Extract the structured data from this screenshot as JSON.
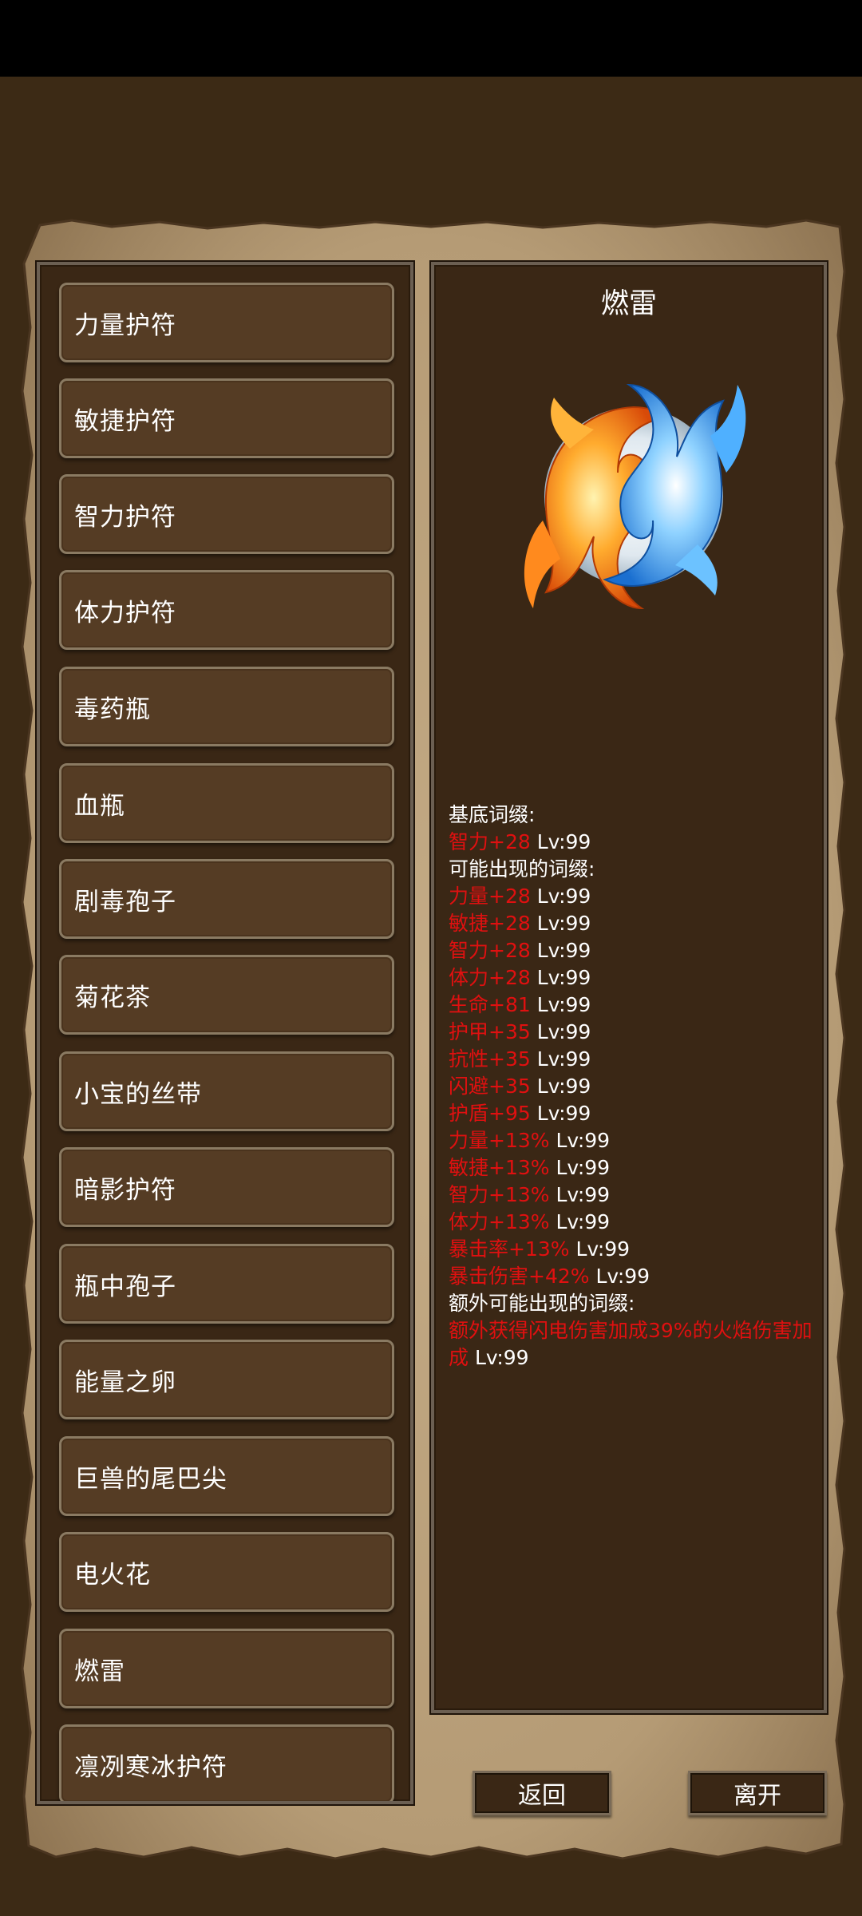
{
  "list": {
    "items": [
      {
        "label": "力量护符"
      },
      {
        "label": "敏捷护符"
      },
      {
        "label": "智力护符"
      },
      {
        "label": "体力护符"
      },
      {
        "label": "毒药瓶"
      },
      {
        "label": "血瓶"
      },
      {
        "label": "剧毒孢子"
      },
      {
        "label": "菊花茶"
      },
      {
        "label": "小宝的丝带"
      },
      {
        "label": "暗影护符"
      },
      {
        "label": "瓶中孢子"
      },
      {
        "label": "能量之卵"
      },
      {
        "label": "巨兽的尾巴尖"
      },
      {
        "label": "电火花"
      },
      {
        "label": "燃雷"
      },
      {
        "label": "凛冽寒冰护符"
      }
    ]
  },
  "detail": {
    "title": "燃雷",
    "icon": "fire-ice-yin-yang-icon",
    "base_header": "基底词缀:",
    "base_affixes": [
      {
        "stat": "智力+28",
        "level": "Lv:99"
      }
    ],
    "possible_header": "可能出现的词缀:",
    "possible_affixes": [
      {
        "stat": "力量+28",
        "level": "Lv:99"
      },
      {
        "stat": "敏捷+28",
        "level": "Lv:99"
      },
      {
        "stat": "智力+28",
        "level": "Lv:99"
      },
      {
        "stat": "体力+28",
        "level": "Lv:99"
      },
      {
        "stat": "生命+81",
        "level": "Lv:99"
      },
      {
        "stat": "护甲+35",
        "level": "Lv:99"
      },
      {
        "stat": "抗性+35",
        "level": "Lv:99"
      },
      {
        "stat": "闪避+35",
        "level": "Lv:99"
      },
      {
        "stat": "护盾+95",
        "level": "Lv:99"
      },
      {
        "stat": "力量+13%",
        "level": "Lv:99"
      },
      {
        "stat": "敏捷+13%",
        "level": "Lv:99"
      },
      {
        "stat": "智力+13%",
        "level": "Lv:99"
      },
      {
        "stat": "体力+13%",
        "level": "Lv:99"
      },
      {
        "stat": "暴击率+13%",
        "level": "Lv:99"
      },
      {
        "stat": "暴击伤害+42%",
        "level": "Lv:99"
      }
    ],
    "extra_header": "额外可能出现的词缀:",
    "extra_affixes": [
      {
        "stat": "额外获得闪电伤害加成39%的火焰伤害加成",
        "level": "Lv:99"
      }
    ]
  },
  "buttons": {
    "back": "返回",
    "leave": "离开"
  },
  "colors": {
    "affix_red": "#e01010",
    "panel_bg": "#3a2715",
    "parchment": "#b8a07c"
  }
}
